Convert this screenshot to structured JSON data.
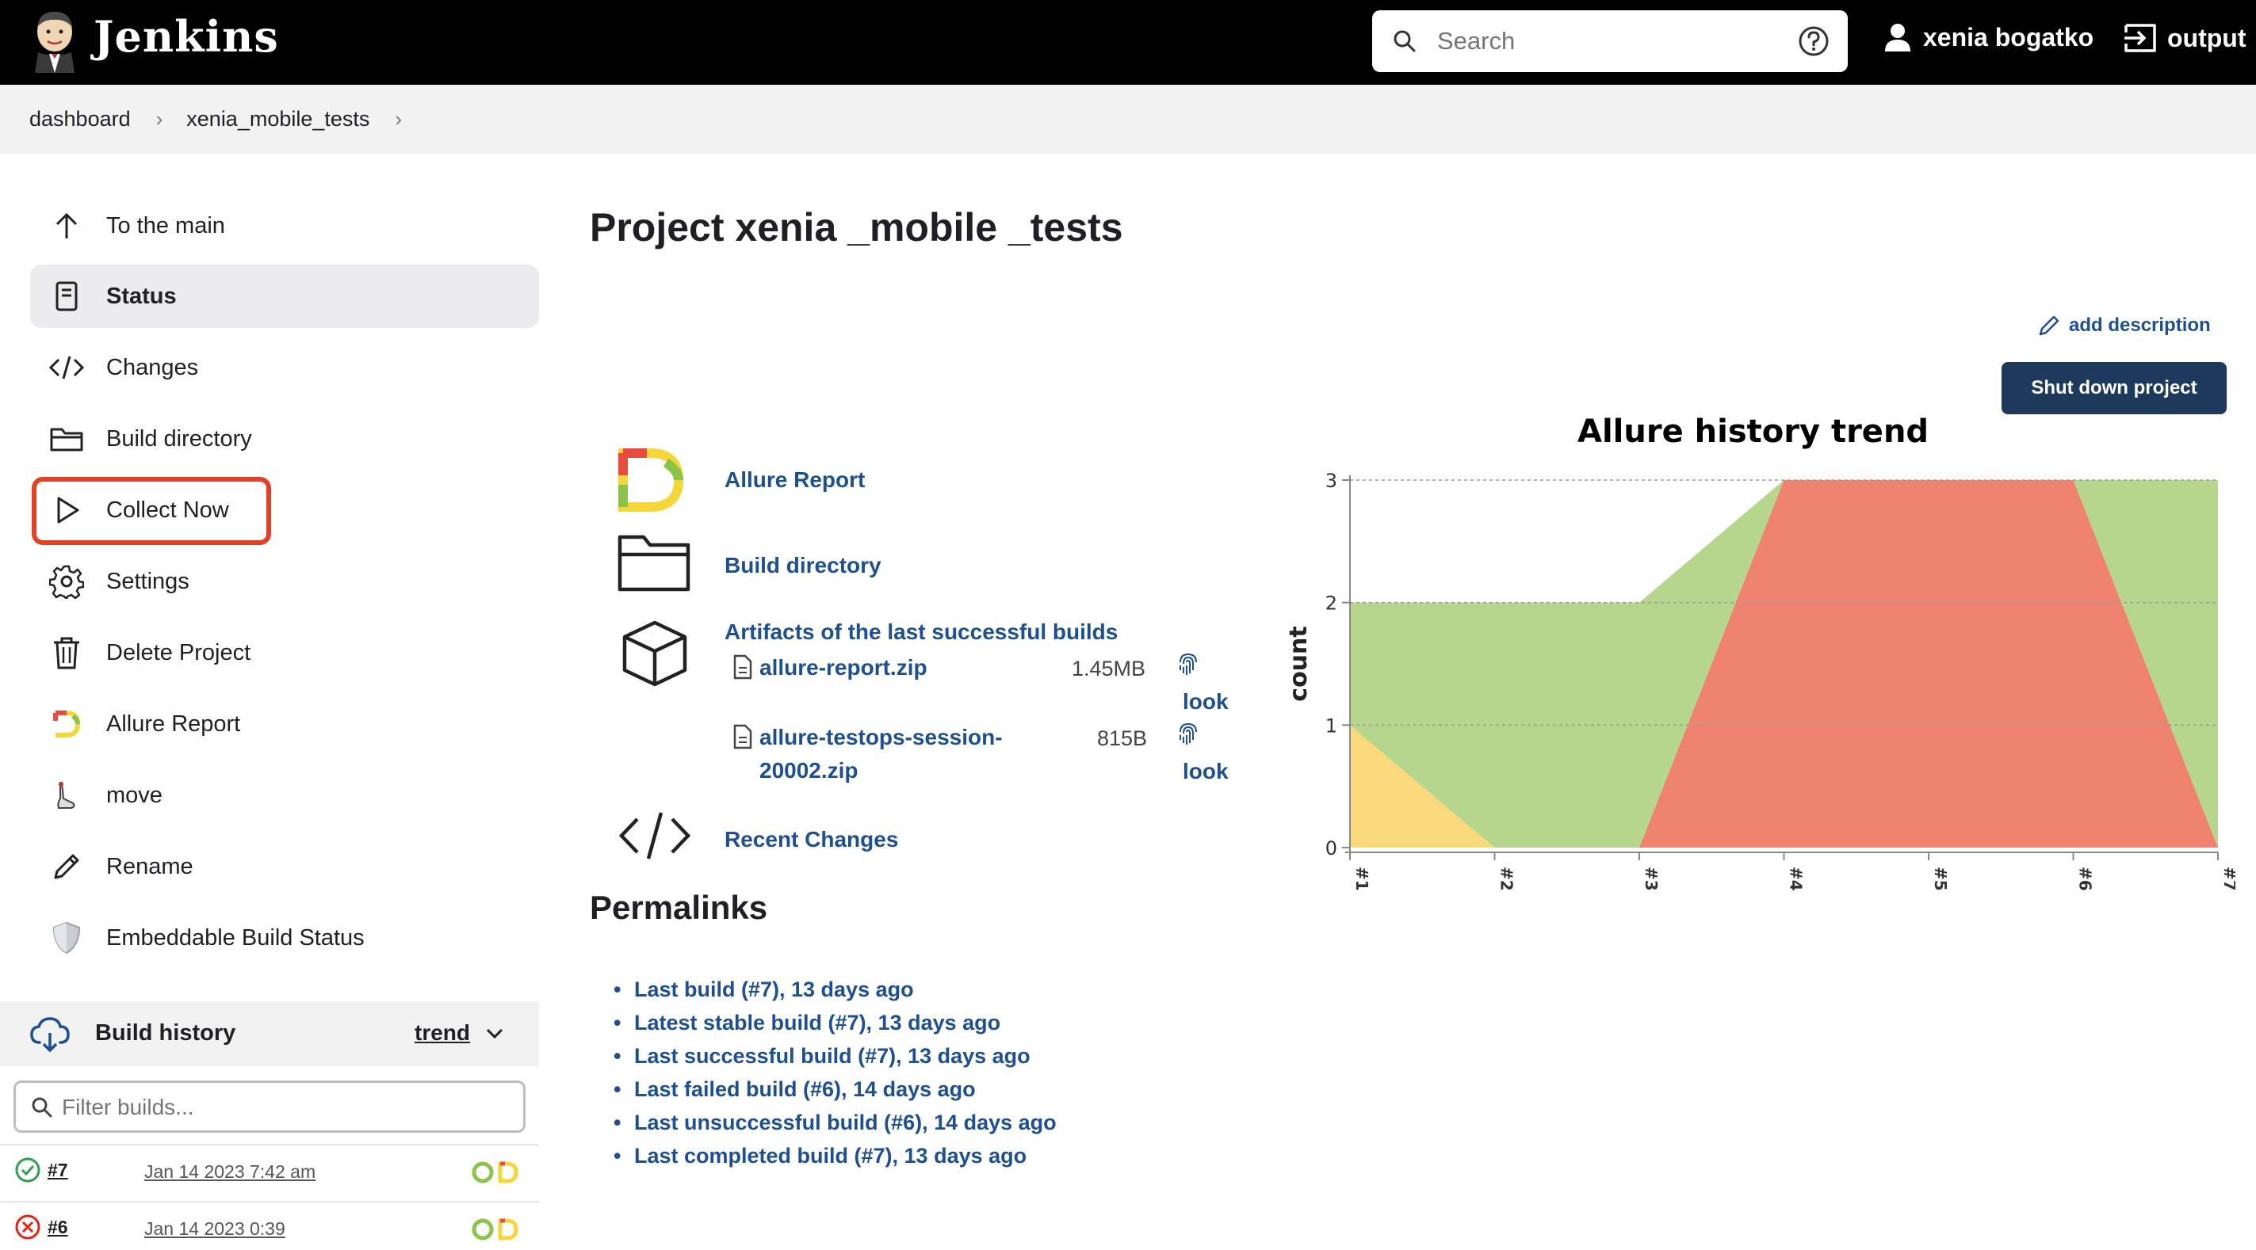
{
  "header": {
    "app_name": "Jenkins",
    "search_placeholder": "Search",
    "user_name": "xenia bogatko",
    "logout_label": "output"
  },
  "breadcrumb": [
    "dashboard",
    "xenia_mobile_tests"
  ],
  "sidebar": {
    "items": [
      {
        "label": "To the main",
        "icon": "arrow-up-icon"
      },
      {
        "label": "Status",
        "icon": "document-icon"
      },
      {
        "label": "Changes",
        "icon": "code-icon"
      },
      {
        "label": "Build directory",
        "icon": "folder-icon"
      },
      {
        "label": "Collect Now",
        "icon": "play-icon"
      },
      {
        "label": "Settings",
        "icon": "gear-icon"
      },
      {
        "label": "Delete Project",
        "icon": "trash-icon"
      },
      {
        "label": "Allure Report",
        "icon": "allure-icon"
      },
      {
        "label": "move",
        "icon": "move-icon"
      },
      {
        "label": "Rename",
        "icon": "pencil-icon"
      },
      {
        "label": "Embeddable Build Status",
        "icon": "shield-icon"
      }
    ],
    "build_history": {
      "title": "Build history",
      "trend_label": "trend",
      "filter_placeholder": "Filter builds...",
      "builds": [
        {
          "number": "#7",
          "date": "Jan 14 2023 7:42 am",
          "status": "success"
        },
        {
          "number": "#6",
          "date": "Jan 14 2023 0:39",
          "status": "failed"
        }
      ]
    }
  },
  "main": {
    "title": "Project xenia _mobile _tests",
    "add_description": "add description",
    "shutdown_button": "Shut down project",
    "links": {
      "allure_report": "Allure Report",
      "build_directory": "Build directory",
      "artifacts_title": "Artifacts of the last successful builds",
      "recent_changes": "Recent Changes"
    },
    "artifacts": [
      {
        "name_line1": "allure-report.zip",
        "name_line2": "",
        "size": "1.45MB",
        "look": "look"
      },
      {
        "name_line1": "allure-testops-session-",
        "name_line2": "20002.zip",
        "size": "815B",
        "look": "look"
      }
    ],
    "permalinks_title": "Permalinks",
    "permalinks": [
      "Last build (#7), 13 days ago",
      "Latest stable build (#7), 13 days ago",
      "Last successful build (#7), 13 days ago",
      "Last failed build (#6), 14 days ago",
      "Last unsuccessful build (#6), 14 days ago",
      "Last completed build (#7), 13 days ago"
    ]
  },
  "colors": {
    "passed": "#b5d68c",
    "failed": "#ef8370",
    "broken": "#fad97c",
    "link": "#1d4f91",
    "highlight": "#e34125"
  },
  "chart_data": {
    "type": "area",
    "title": "Allure history trend",
    "ylabel": "count",
    "xlabel": "",
    "categories": [
      "#1",
      "#2",
      "#3",
      "#4",
      "#5",
      "#6",
      "#7"
    ],
    "ylim": [
      0,
      3
    ],
    "yticks": [
      0,
      1,
      2,
      3
    ],
    "stacked": true,
    "series": [
      {
        "key": "broken",
        "values": [
          1,
          0,
          0,
          0,
          0,
          0,
          0
        ]
      },
      {
        "key": "failed",
        "values": [
          0,
          0,
          0,
          3,
          3,
          3,
          0
        ]
      },
      {
        "key": "passed",
        "values": [
          1,
          2,
          2,
          0,
          0,
          0,
          3
        ]
      }
    ]
  }
}
